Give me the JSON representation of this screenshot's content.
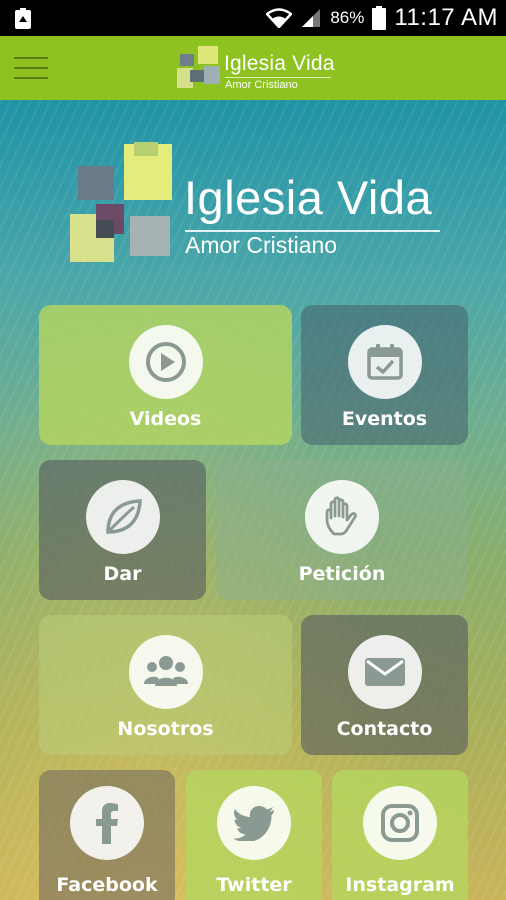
{
  "status_bar": {
    "battery_percent": "86%",
    "time": "11:17 AM"
  },
  "app_bar": {
    "logo_title": "Iglesia Vida",
    "logo_subtitle": "Amor Cristiano"
  },
  "hero": {
    "title": "Iglesia Vida",
    "subtitle": "Amor Cristiano"
  },
  "tiles": [
    {
      "label": "Videos",
      "icon": "play-icon"
    },
    {
      "label": "Eventos",
      "icon": "calendar-icon"
    },
    {
      "label": "Dar",
      "icon": "leaf-icon"
    },
    {
      "label": "Petición",
      "icon": "hand-icon"
    },
    {
      "label": "Nosotros",
      "icon": "group-icon"
    },
    {
      "label": "Contacto",
      "icon": "envelope-icon"
    },
    {
      "label": "Facebook",
      "icon": "facebook-icon"
    },
    {
      "label": "Twitter",
      "icon": "twitter-icon"
    },
    {
      "label": "Instagram",
      "icon": "instagram-icon"
    }
  ],
  "colors": {
    "brand_green": "#8dc220",
    "icon_color": "#8a9a93"
  }
}
